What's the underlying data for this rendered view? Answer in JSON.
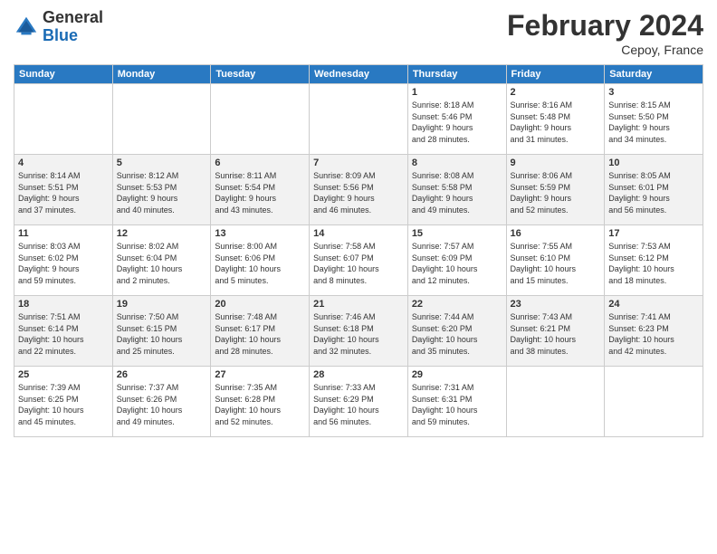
{
  "header": {
    "logo_general": "General",
    "logo_blue": "Blue",
    "title": "February 2024",
    "location": "Cepoy, France"
  },
  "days_of_week": [
    "Sunday",
    "Monday",
    "Tuesday",
    "Wednesday",
    "Thursday",
    "Friday",
    "Saturday"
  ],
  "weeks": [
    [
      {
        "day": "",
        "info": ""
      },
      {
        "day": "",
        "info": ""
      },
      {
        "day": "",
        "info": ""
      },
      {
        "day": "",
        "info": ""
      },
      {
        "day": "1",
        "info": "Sunrise: 8:18 AM\nSunset: 5:46 PM\nDaylight: 9 hours\nand 28 minutes."
      },
      {
        "day": "2",
        "info": "Sunrise: 8:16 AM\nSunset: 5:48 PM\nDaylight: 9 hours\nand 31 minutes."
      },
      {
        "day": "3",
        "info": "Sunrise: 8:15 AM\nSunset: 5:50 PM\nDaylight: 9 hours\nand 34 minutes."
      }
    ],
    [
      {
        "day": "4",
        "info": "Sunrise: 8:14 AM\nSunset: 5:51 PM\nDaylight: 9 hours\nand 37 minutes."
      },
      {
        "day": "5",
        "info": "Sunrise: 8:12 AM\nSunset: 5:53 PM\nDaylight: 9 hours\nand 40 minutes."
      },
      {
        "day": "6",
        "info": "Sunrise: 8:11 AM\nSunset: 5:54 PM\nDaylight: 9 hours\nand 43 minutes."
      },
      {
        "day": "7",
        "info": "Sunrise: 8:09 AM\nSunset: 5:56 PM\nDaylight: 9 hours\nand 46 minutes."
      },
      {
        "day": "8",
        "info": "Sunrise: 8:08 AM\nSunset: 5:58 PM\nDaylight: 9 hours\nand 49 minutes."
      },
      {
        "day": "9",
        "info": "Sunrise: 8:06 AM\nSunset: 5:59 PM\nDaylight: 9 hours\nand 52 minutes."
      },
      {
        "day": "10",
        "info": "Sunrise: 8:05 AM\nSunset: 6:01 PM\nDaylight: 9 hours\nand 56 minutes."
      }
    ],
    [
      {
        "day": "11",
        "info": "Sunrise: 8:03 AM\nSunset: 6:02 PM\nDaylight: 9 hours\nand 59 minutes."
      },
      {
        "day": "12",
        "info": "Sunrise: 8:02 AM\nSunset: 6:04 PM\nDaylight: 10 hours\nand 2 minutes."
      },
      {
        "day": "13",
        "info": "Sunrise: 8:00 AM\nSunset: 6:06 PM\nDaylight: 10 hours\nand 5 minutes."
      },
      {
        "day": "14",
        "info": "Sunrise: 7:58 AM\nSunset: 6:07 PM\nDaylight: 10 hours\nand 8 minutes."
      },
      {
        "day": "15",
        "info": "Sunrise: 7:57 AM\nSunset: 6:09 PM\nDaylight: 10 hours\nand 12 minutes."
      },
      {
        "day": "16",
        "info": "Sunrise: 7:55 AM\nSunset: 6:10 PM\nDaylight: 10 hours\nand 15 minutes."
      },
      {
        "day": "17",
        "info": "Sunrise: 7:53 AM\nSunset: 6:12 PM\nDaylight: 10 hours\nand 18 minutes."
      }
    ],
    [
      {
        "day": "18",
        "info": "Sunrise: 7:51 AM\nSunset: 6:14 PM\nDaylight: 10 hours\nand 22 minutes."
      },
      {
        "day": "19",
        "info": "Sunrise: 7:50 AM\nSunset: 6:15 PM\nDaylight: 10 hours\nand 25 minutes."
      },
      {
        "day": "20",
        "info": "Sunrise: 7:48 AM\nSunset: 6:17 PM\nDaylight: 10 hours\nand 28 minutes."
      },
      {
        "day": "21",
        "info": "Sunrise: 7:46 AM\nSunset: 6:18 PM\nDaylight: 10 hours\nand 32 minutes."
      },
      {
        "day": "22",
        "info": "Sunrise: 7:44 AM\nSunset: 6:20 PM\nDaylight: 10 hours\nand 35 minutes."
      },
      {
        "day": "23",
        "info": "Sunrise: 7:43 AM\nSunset: 6:21 PM\nDaylight: 10 hours\nand 38 minutes."
      },
      {
        "day": "24",
        "info": "Sunrise: 7:41 AM\nSunset: 6:23 PM\nDaylight: 10 hours\nand 42 minutes."
      }
    ],
    [
      {
        "day": "25",
        "info": "Sunrise: 7:39 AM\nSunset: 6:25 PM\nDaylight: 10 hours\nand 45 minutes."
      },
      {
        "day": "26",
        "info": "Sunrise: 7:37 AM\nSunset: 6:26 PM\nDaylight: 10 hours\nand 49 minutes."
      },
      {
        "day": "27",
        "info": "Sunrise: 7:35 AM\nSunset: 6:28 PM\nDaylight: 10 hours\nand 52 minutes."
      },
      {
        "day": "28",
        "info": "Sunrise: 7:33 AM\nSunset: 6:29 PM\nDaylight: 10 hours\nand 56 minutes."
      },
      {
        "day": "29",
        "info": "Sunrise: 7:31 AM\nSunset: 6:31 PM\nDaylight: 10 hours\nand 59 minutes."
      },
      {
        "day": "",
        "info": ""
      },
      {
        "day": "",
        "info": ""
      }
    ]
  ]
}
